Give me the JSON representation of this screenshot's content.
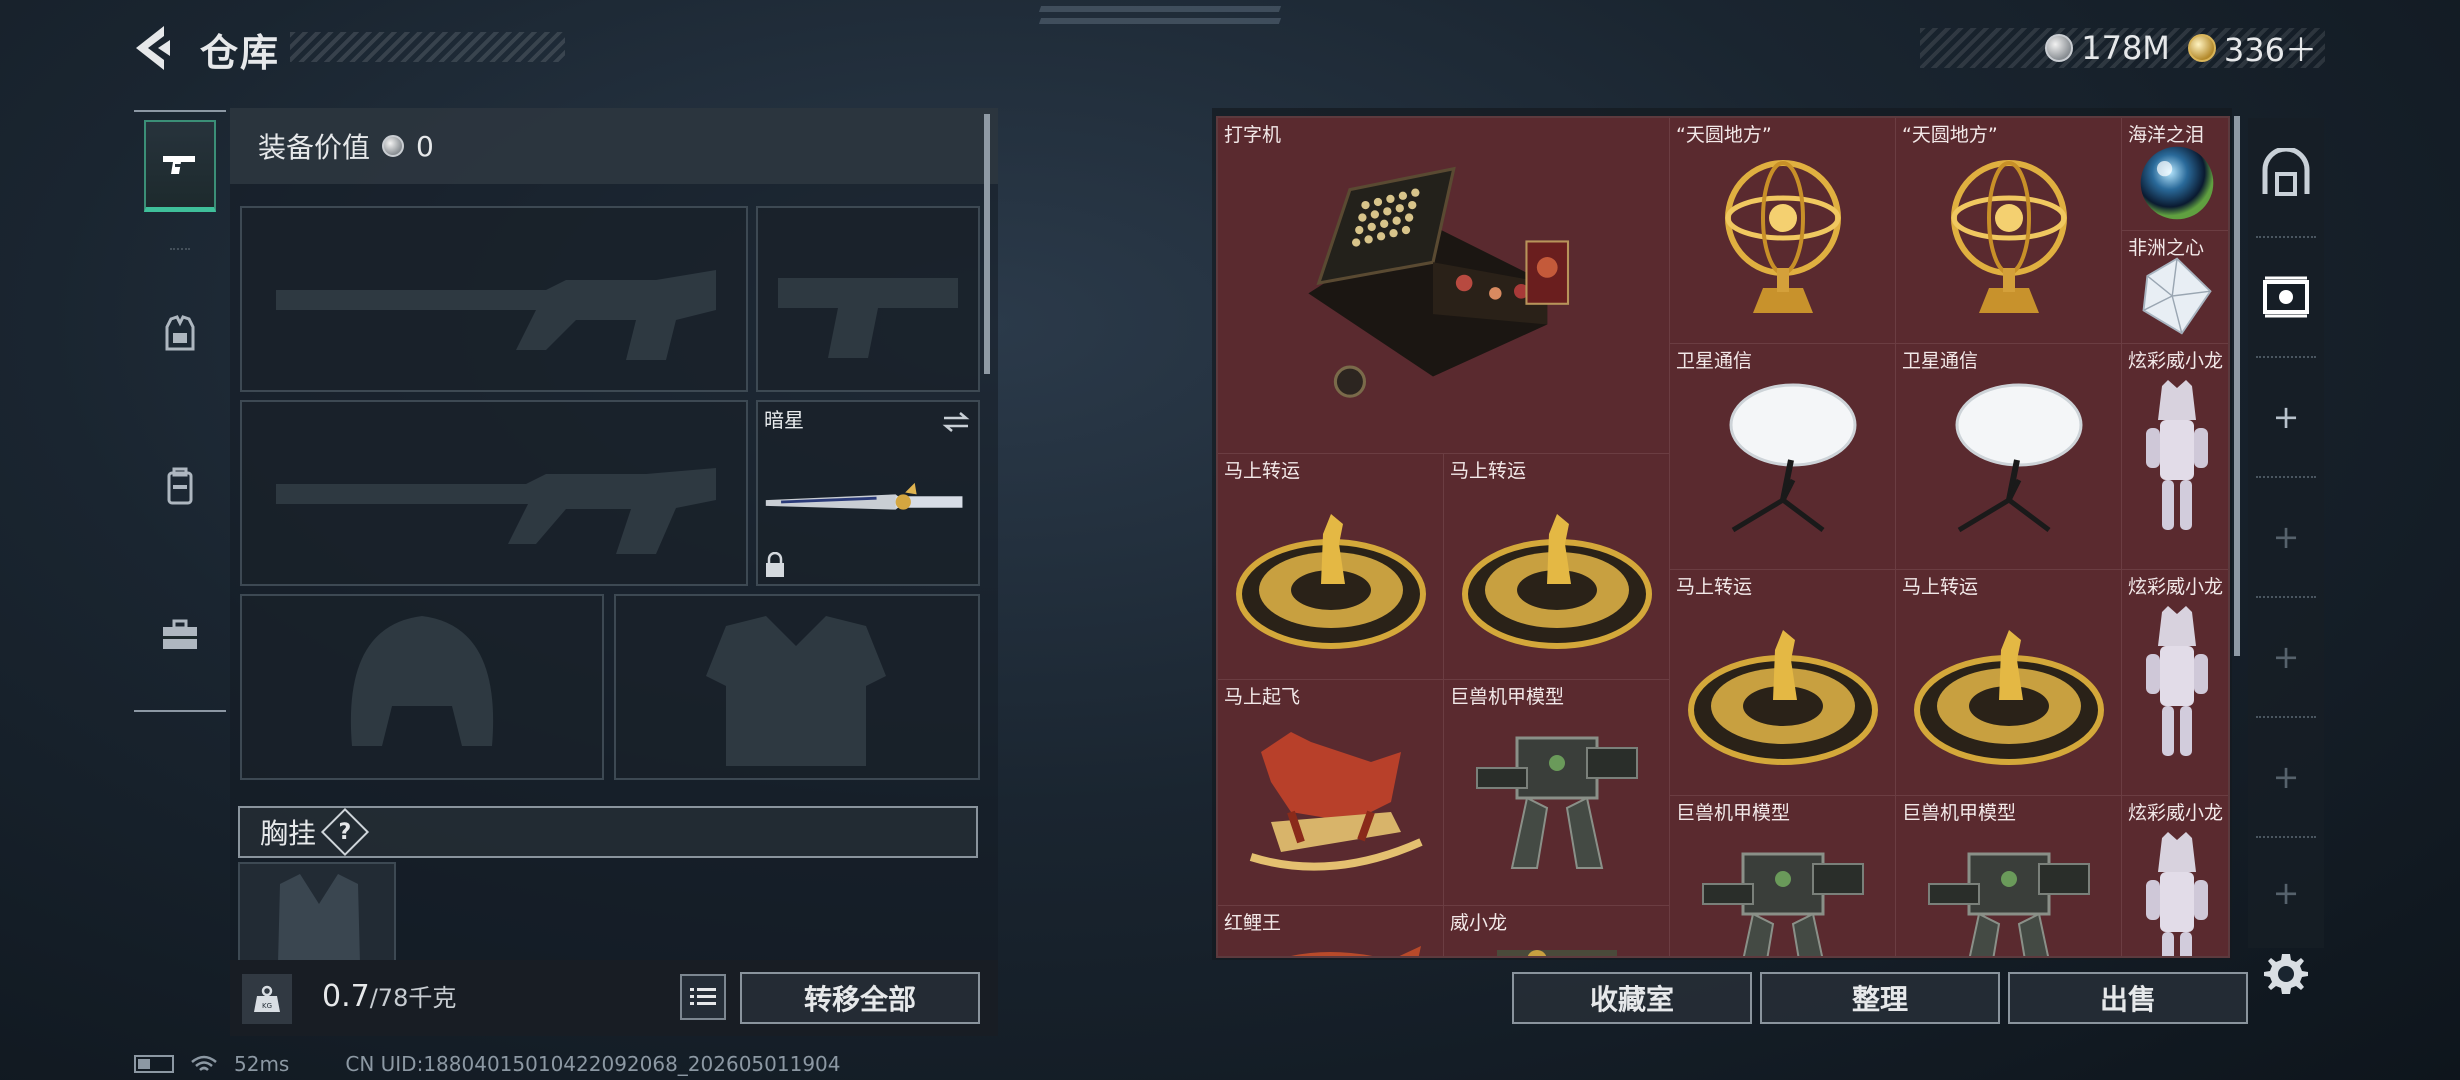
{
  "header": {
    "title": "仓库",
    "currencies": [
      {
        "icon": "silver-coin-icon",
        "value": "178M"
      },
      {
        "icon": "gold-coin-icon",
        "value": "336＋"
      }
    ]
  },
  "equipment": {
    "value_label": "装备价值",
    "value": "0",
    "secondary_weapon_name": "暗星",
    "chest_rig_label": "胸挂",
    "help": "?"
  },
  "capacity": {
    "current": "0.7",
    "max": "/78千克"
  },
  "actions": {
    "transfer_all": "转移全部",
    "collection": "收藏室",
    "organize": "整理",
    "sell": "出售"
  },
  "grid_items": [
    {
      "name": "打字机"
    },
    {
      "name": "“天圆地方”"
    },
    {
      "name": "“天圆地方”"
    },
    {
      "name": "海洋之泪"
    },
    {
      "name": "非洲之心"
    },
    {
      "name": "卫星通信"
    },
    {
      "name": "卫星通信"
    },
    {
      "name": "炫彩威小龙"
    },
    {
      "name": "马上转运"
    },
    {
      "name": "马上转运"
    },
    {
      "name": "马上转运"
    },
    {
      "name": "马上转运"
    },
    {
      "name": "炫彩威小龙"
    },
    {
      "name": "马上起飞"
    },
    {
      "name": "巨兽机甲模型"
    },
    {
      "name": "巨兽机甲模型"
    },
    {
      "name": "巨兽机甲模型"
    },
    {
      "name": "炫彩威小龙"
    },
    {
      "name": "红鲤王"
    },
    {
      "name": "威小龙"
    }
  ],
  "colors": {
    "accent": "#3fbf9a",
    "grid_background": "#5a2a2f",
    "panel": "#1a2530"
  },
  "status": {
    "ping": "52ms",
    "uid": "CN UID:18804015010422092068_202605011904"
  }
}
